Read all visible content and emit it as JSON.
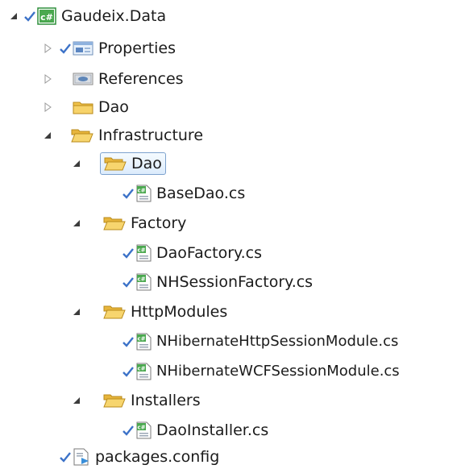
{
  "tree": {
    "project": {
      "label": "Gaudeix.Data"
    },
    "properties": {
      "label": "Properties"
    },
    "references": {
      "label": "References"
    },
    "dao_root": {
      "label": "Dao"
    },
    "infrastructure": {
      "label": "Infrastructure"
    },
    "infra_dao": {
      "label": "Dao"
    },
    "base_dao": {
      "label": "BaseDao.cs"
    },
    "factory": {
      "label": "Factory"
    },
    "dao_factory": {
      "label": "DaoFactory.cs"
    },
    "nh_session_factory": {
      "label": "NHSessionFactory.cs"
    },
    "http_modules": {
      "label": "HttpModules"
    },
    "nh_http_module": {
      "label": "NHibernateHttpSessionModule.cs"
    },
    "nh_wcf_module": {
      "label": "NHibernateWCFSessionModule.cs"
    },
    "installers": {
      "label": "Installers"
    },
    "dao_installer": {
      "label": "DaoInstaller.cs"
    },
    "packages_config": {
      "label": "packages.config"
    },
    "cs_badge": "c#"
  }
}
